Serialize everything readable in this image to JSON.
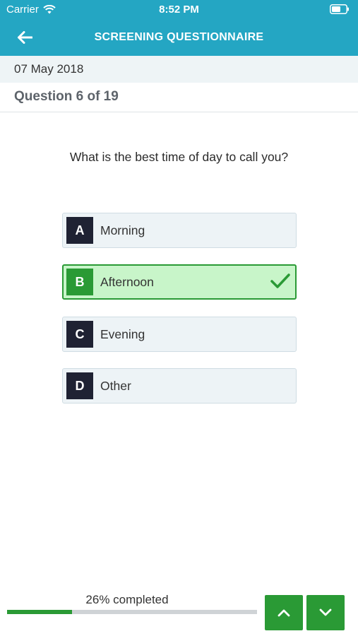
{
  "status_bar": {
    "carrier": "Carrier",
    "time": "8:52 PM",
    "wifi_icon": "wifi-icon",
    "battery_icon": "battery-icon"
  },
  "header": {
    "title": "SCREENING QUESTIONNAIRE",
    "back_icon": "arrow-left-icon",
    "background_color": "#24a6c3"
  },
  "date": "07 May 2018",
  "question_counter": "Question 6 of 19",
  "question": {
    "text": "What is the best time of day to call you?",
    "options": [
      {
        "letter": "A",
        "label": "Morning",
        "selected": false
      },
      {
        "letter": "B",
        "label": "Afternoon",
        "selected": true
      },
      {
        "letter": "C",
        "label": "Evening",
        "selected": false
      },
      {
        "letter": "D",
        "label": "Other",
        "selected": false
      }
    ],
    "selected_color": "#2a9a35",
    "check_icon": "checkmark-icon"
  },
  "progress": {
    "text": "26% completed",
    "fraction": 0.26
  },
  "navigation": {
    "prev_icon": "chevron-up-icon",
    "next_icon": "chevron-down-icon"
  }
}
